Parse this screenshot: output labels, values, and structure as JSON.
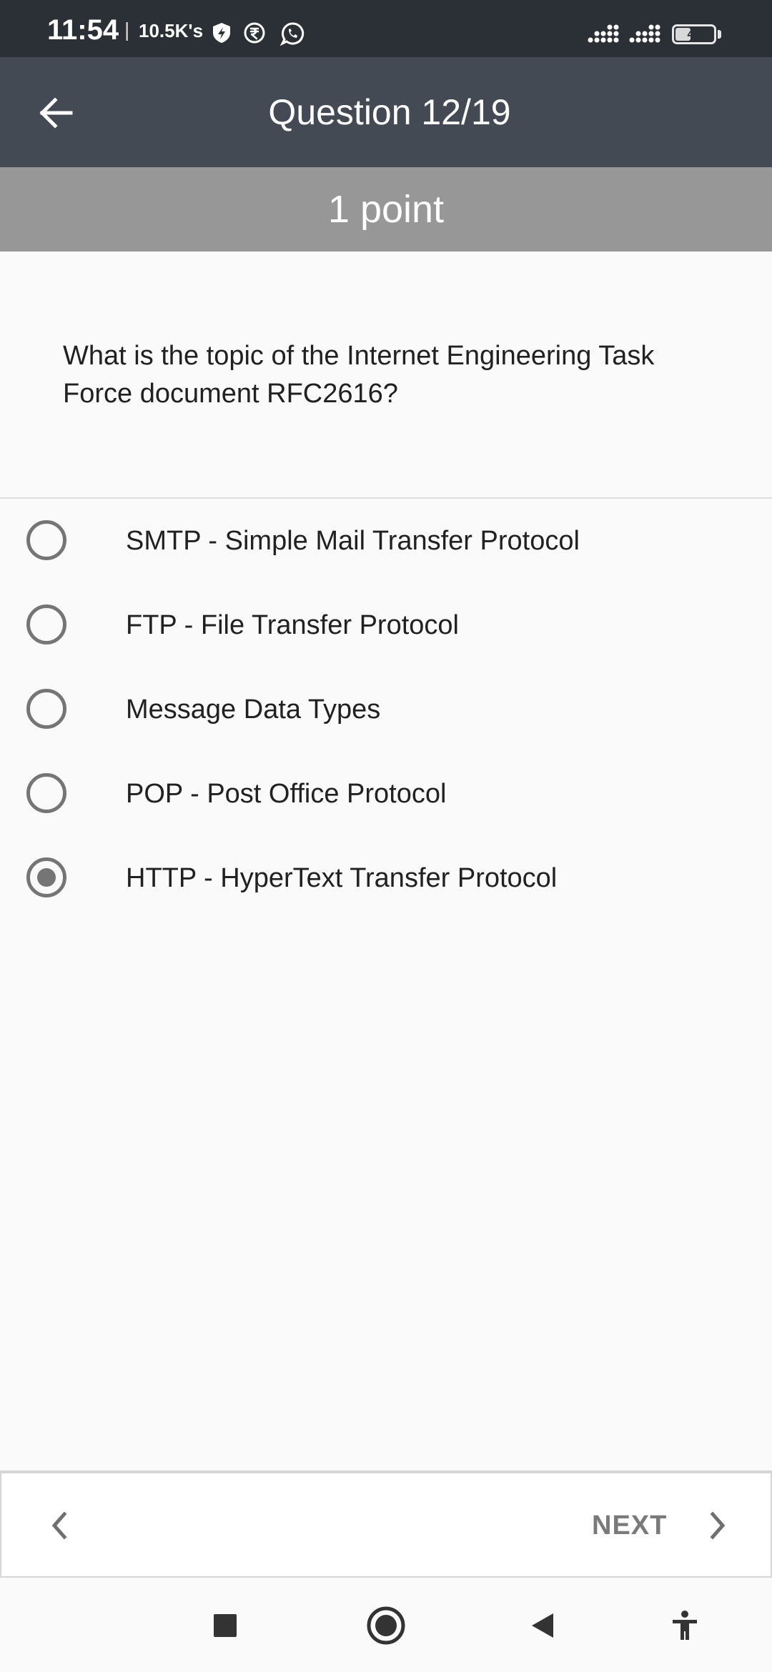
{
  "status_bar": {
    "time": "11:54",
    "separator": "|",
    "network_speed": "10.5K's",
    "battery_level": "41",
    "battery_percent": 41
  },
  "app_bar": {
    "back_icon": "arrow-left-icon",
    "title": "Question 12/19"
  },
  "points": {
    "label": "1 point"
  },
  "question": {
    "text": "What is the topic of the Internet Engineering Task Force document RFC2616?"
  },
  "options": [
    {
      "label": "SMTP - Simple Mail Transfer Protocol",
      "selected": false
    },
    {
      "label": "FTP - File Transfer Protocol",
      "selected": false
    },
    {
      "label": "Message Data Types",
      "selected": false
    },
    {
      "label": "POP - Post Office Protocol",
      "selected": false
    },
    {
      "label": "HTTP - HyperText Transfer Protocol",
      "selected": true
    }
  ],
  "bottom_nav": {
    "next_label": "NEXT",
    "prev_icon": "chevron-left-icon",
    "next_icon": "chevron-right-icon"
  },
  "system_nav": {
    "icons": [
      "square-recents-icon",
      "circle-home-icon",
      "triangle-back-icon",
      "accessibility-icon"
    ]
  },
  "colors": {
    "status_bar": "#2b2f36",
    "app_bar": "#444a54",
    "points_bar": "#979797",
    "radio": "#757575",
    "background": "#fafafa"
  }
}
